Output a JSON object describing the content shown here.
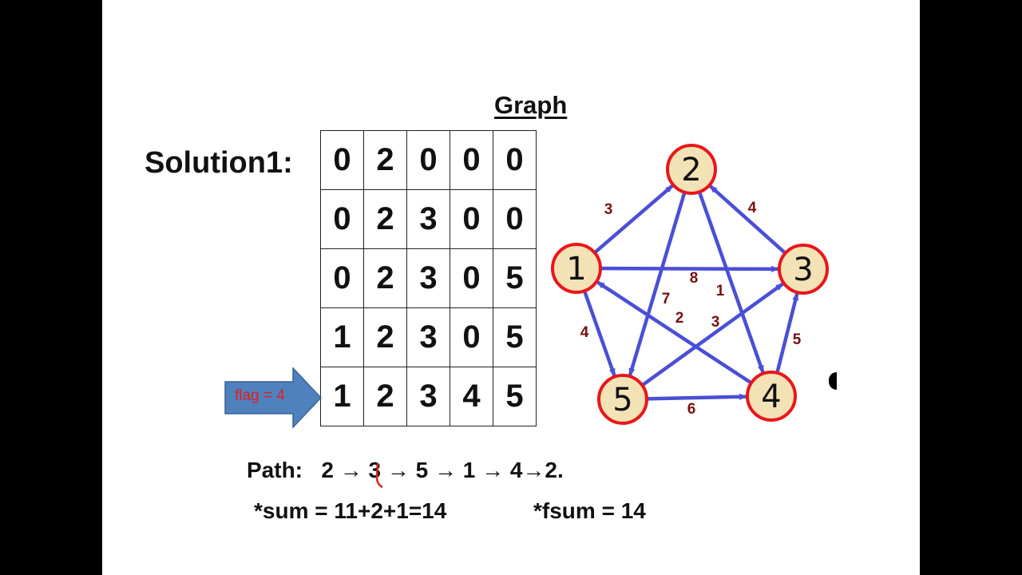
{
  "slide": {
    "title": "Graph",
    "solution_label": "Solution1:",
    "matrix": [
      [
        "0",
        "2",
        "0",
        "0",
        "0"
      ],
      [
        "0",
        "2",
        "3",
        "0",
        "0"
      ],
      [
        "0",
        "2",
        "3",
        "0",
        "5"
      ],
      [
        "1",
        "2",
        "3",
        "0",
        "5"
      ],
      [
        "1",
        "2",
        "3",
        "4",
        "5"
      ]
    ],
    "flag_label": "flag = 4",
    "path_text": "Path:   2 → 3 → 5 → 1 → 4→2.",
    "sum_text": "*sum = 11+2+1=14",
    "fsum_text": "*fsum = 14"
  },
  "graph": {
    "colors": {
      "edge": "#4a4fd6",
      "node_fill": "#f3e2b5",
      "node_border": "#e8161b",
      "weight": "#7a1010"
    },
    "nodes": [
      {
        "id": "1",
        "label": "1"
      },
      {
        "id": "2",
        "label": "2"
      },
      {
        "id": "3",
        "label": "3"
      },
      {
        "id": "4",
        "label": "4"
      },
      {
        "id": "5",
        "label": "5"
      }
    ],
    "edges": [
      {
        "from": "1",
        "to": "2",
        "weight": "3"
      },
      {
        "from": "3",
        "to": "2",
        "weight": "4"
      },
      {
        "from": "1",
        "to": "3",
        "weight": "8"
      },
      {
        "from": "2",
        "to": "5",
        "weight": "7"
      },
      {
        "from": "2",
        "to": "4",
        "weight": "1"
      },
      {
        "from": "4",
        "to": "1",
        "weight": "2"
      },
      {
        "from": "5",
        "to": "3",
        "weight": "3"
      },
      {
        "from": "1",
        "to": "5",
        "weight": "4"
      },
      {
        "from": "4",
        "to": "3",
        "weight": "5"
      },
      {
        "from": "5",
        "to": "4",
        "weight": "6"
      }
    ]
  }
}
